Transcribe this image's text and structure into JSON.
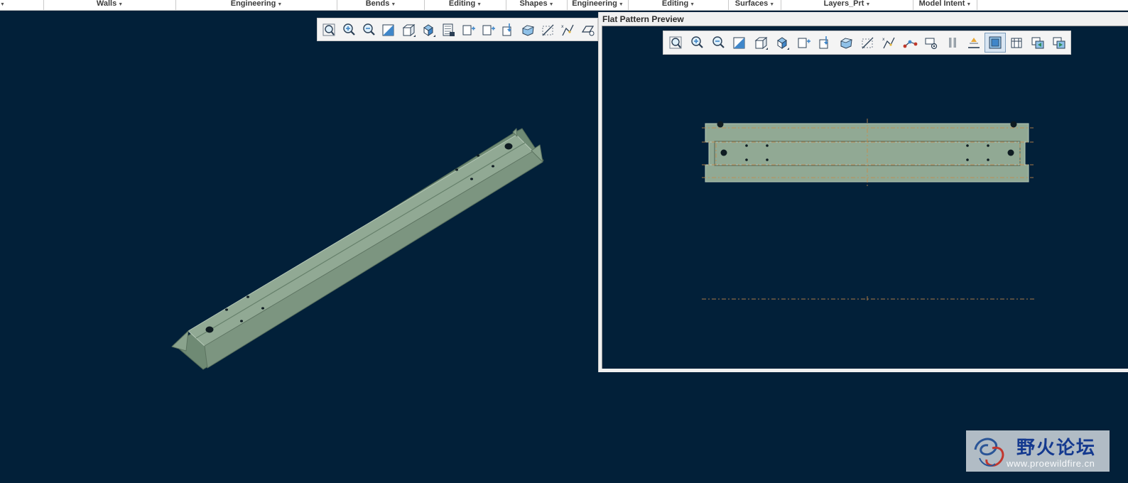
{
  "ribbon": {
    "groups": [
      {
        "label": "",
        "name": "group-partial"
      },
      {
        "label": "Walls",
        "name": "group-walls"
      },
      {
        "label": "Engineering",
        "name": "group-engineering"
      },
      {
        "label": "Bends",
        "name": "group-bends"
      },
      {
        "label": "Editing",
        "name": "group-editing"
      },
      {
        "label": "Shapes",
        "name": "group-shapes"
      },
      {
        "label": "Engineering",
        "name": "group-engineering-2"
      },
      {
        "label": "Editing",
        "name": "group-editing-2"
      },
      {
        "label": "Surfaces",
        "name": "group-surfaces"
      },
      {
        "label": "Layers_Prt",
        "name": "group-layers-prt"
      },
      {
        "label": "Model Intent",
        "name": "group-model-intent"
      }
    ]
  },
  "main_view_toolbar": {
    "buttons": [
      "refit-icon",
      "zoom-in-icon",
      "zoom-out-icon",
      "repaint-icon",
      "saved-orientations-icon",
      "display-style-icon",
      "view-manager-icon",
      "named-view-icon",
      "plane-display-icon",
      "axis-display-icon",
      "point-display-icon",
      "csys-display-icon",
      "annotation-display-icon",
      "spin-center-icon"
    ]
  },
  "preview_window": {
    "title": "Flat Pattern Preview",
    "toolbar": {
      "active_index": 15,
      "buttons": [
        "refit-icon",
        "zoom-in-icon",
        "zoom-out-icon",
        "repaint-icon",
        "saved-orientations-icon",
        "display-style-icon",
        "plane-display-icon",
        "axis-display-icon",
        "point-display-icon",
        "csys-display-icon",
        "annotation-display-icon",
        "connect-icon",
        "sketch-view-icon",
        "pause-icon",
        "sheetmetal-display-icon",
        "flat-view-icon",
        "drawing-view-icon",
        "copy-view-icon",
        "export-view-icon"
      ]
    }
  },
  "colors": {
    "background": "#022039",
    "part_top": "#91a994",
    "part_side": "#6f8a74",
    "part_edge": "#b7c9b8",
    "centerline": "#c98a4a"
  },
  "watermark": {
    "text_cn": "野火论坛",
    "url": "www.proewildfire.cn"
  }
}
